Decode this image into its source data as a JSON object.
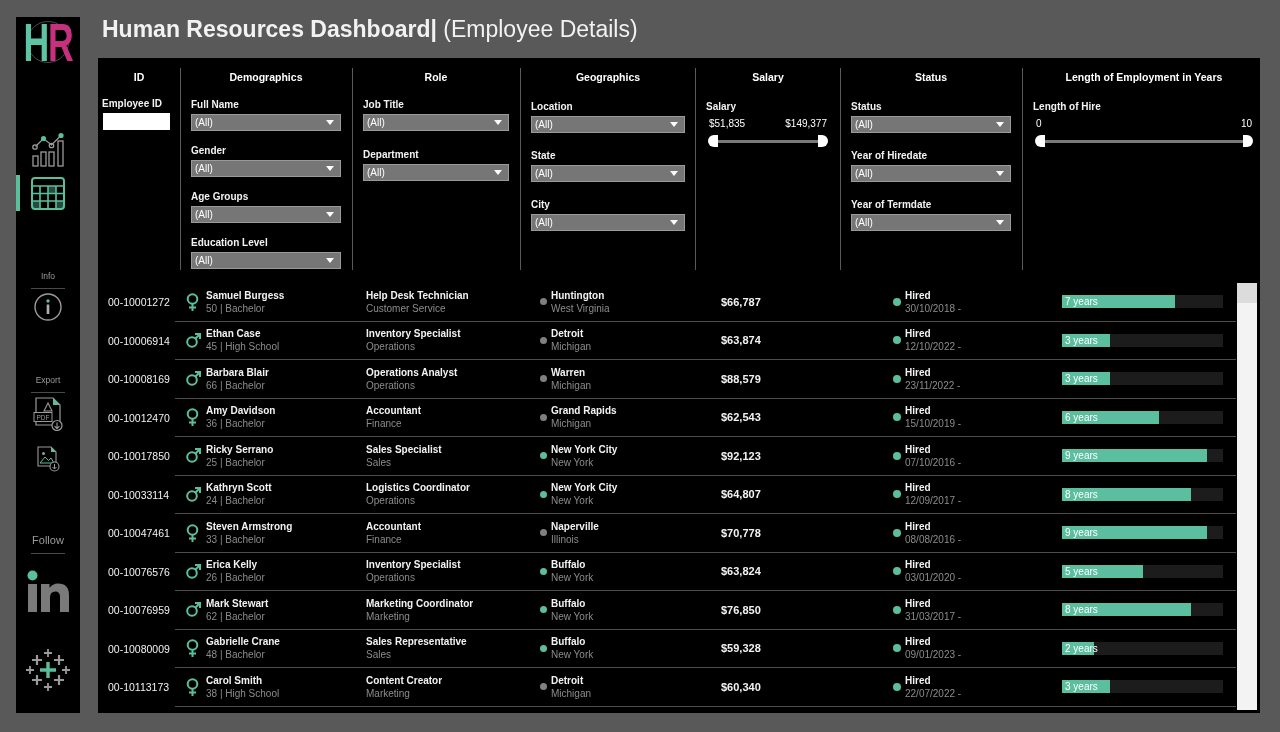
{
  "title": "**Human Resources Dashboard|** (Employee Details)",
  "sidebar": {
    "logo": [
      "H",
      "R"
    ],
    "nav": [
      {
        "kind": "chart",
        "selected": false
      },
      {
        "kind": "table",
        "selected": true
      }
    ],
    "sections": [
      {
        "label": "Info",
        "items": [
          {
            "kind": "info"
          }
        ]
      },
      {
        "label": "Export",
        "items": [
          {
            "kind": "pdf",
            "text": "PDF"
          },
          {
            "kind": "image"
          }
        ]
      },
      {
        "label": "Follow",
        "items": [
          {
            "kind": "linkedin"
          },
          {
            "kind": "tableau"
          }
        ]
      }
    ]
  },
  "filters": [
    {
      "heading": "ID",
      "controls": [
        {
          "kind": "text",
          "label": "Employee ID"
        }
      ]
    },
    {
      "heading": "Demographics",
      "controls": [
        {
          "kind": "dropdown",
          "label": "Full Name",
          "value": "(All)"
        },
        {
          "kind": "dropdown",
          "label": "Gender",
          "value": "(All)"
        },
        {
          "kind": "dropdown",
          "label": "Age Groups",
          "value": "(All)"
        },
        {
          "kind": "dropdown",
          "label": "Education Level",
          "value": "(All)"
        }
      ]
    },
    {
      "heading": "Role",
      "controls": [
        {
          "kind": "dropdown",
          "label": "Job Title",
          "value": "(All)"
        },
        {
          "kind": "dropdown",
          "label": "Department",
          "value": "(All)"
        }
      ]
    },
    {
      "heading": "Geographics",
      "controls": [
        {
          "kind": "dropdown",
          "label": "Location",
          "value": "(All)"
        },
        {
          "kind": "dropdown",
          "label": "State",
          "value": "(All)"
        },
        {
          "kind": "dropdown",
          "label": "City",
          "value": "(All)"
        }
      ]
    },
    {
      "heading": "Salary",
      "controls": [
        {
          "kind": "range",
          "label": "Salary",
          "min": "$51,835",
          "max": "$149,377",
          "handles": [
            {
              "level": 0
            },
            {
              "level": 1
            }
          ]
        }
      ]
    },
    {
      "heading": "Status",
      "controls": [
        {
          "kind": "dropdown",
          "label": "Status",
          "value": "(All)"
        },
        {
          "kind": "dropdown",
          "label": "Year of Hiredate",
          "value": "(All)"
        },
        {
          "kind": "dropdown",
          "label": "Year of Termdate",
          "value": "(All)"
        }
      ]
    },
    {
      "heading": "Length of Employment in Years",
      "controls": [
        {
          "kind": "range",
          "label": "Length of Hire",
          "min": "0",
          "max": "10",
          "handles": [
            {
              "level": 0
            },
            {
              "level": 1
            }
          ]
        }
      ]
    }
  ],
  "table": {
    "rows": [
      {
        "id": "00-10001272",
        "kind": "female",
        "name": "Samuel Burgess",
        "details": "50 | Bachelor",
        "job_title": "Help Desk Technician",
        "department": "Customer Service",
        "location": {
          "color": "#808080",
          "city": "Huntington",
          "state": "West Virginia"
        },
        "salary": "$66,787",
        "status": "Hired",
        "dates": "30/10/2018 -",
        "tenure": {
          "label": "7 years",
          "level": 0.7
        }
      },
      {
        "id": "00-10006914",
        "kind": "male",
        "name": "Ethan Case",
        "details": "45 | High School",
        "job_title": "Inventory Specialist",
        "department": "Operations",
        "location": {
          "color": "#808080",
          "city": "Detroit",
          "state": "Michigan"
        },
        "salary": "$63,874",
        "status": "Hired",
        "dates": "12/10/2022 -",
        "tenure": {
          "label": "3 years",
          "level": 0.3
        }
      },
      {
        "id": "00-10008169",
        "kind": "male",
        "name": "Barbara Blair",
        "details": "66 | Bachelor",
        "job_title": "Operations Analyst",
        "department": "Operations",
        "location": {
          "color": "#808080",
          "city": "Warren",
          "state": "Michigan"
        },
        "salary": "$88,579",
        "status": "Hired",
        "dates": "23/11/2022 -",
        "tenure": {
          "label": "3 years",
          "level": 0.3
        }
      },
      {
        "id": "00-10012470",
        "kind": "female",
        "name": "Amy Davidson",
        "details": "36 | Bachelor",
        "job_title": "Accountant",
        "department": "Finance",
        "location": {
          "color": "#808080",
          "city": "Grand Rapids",
          "state": "Michigan"
        },
        "salary": "$62,543",
        "status": "Hired",
        "dates": "15/10/2019 -",
        "tenure": {
          "label": "6 years",
          "level": 0.6
        }
      },
      {
        "id": "00-10017850",
        "kind": "male",
        "name": "Ricky Serrano",
        "details": "25 | Bachelor",
        "job_title": "Sales Specialist",
        "department": "Sales",
        "location": {
          "color": "#5bbf9f",
          "city": "New York City",
          "state": "New York"
        },
        "salary": "$92,123",
        "status": "Hired",
        "dates": "07/10/2016 -",
        "tenure": {
          "label": "9 years",
          "level": 0.9
        }
      },
      {
        "id": "00-10033114",
        "kind": "male",
        "name": "Kathryn Scott",
        "details": "24 | Bachelor",
        "job_title": "Logistics Coordinator",
        "department": "Operations",
        "location": {
          "color": "#5bbf9f",
          "city": "New York City",
          "state": "New York"
        },
        "salary": "$64,807",
        "status": "Hired",
        "dates": "12/09/2017 -",
        "tenure": {
          "label": "8 years",
          "level": 0.8
        }
      },
      {
        "id": "00-10047461",
        "kind": "female",
        "name": "Steven Armstrong",
        "details": "33 | Bachelor",
        "job_title": "Accountant",
        "department": "Finance",
        "location": {
          "color": "#808080",
          "city": "Naperville",
          "state": "Illinois"
        },
        "salary": "$70,778",
        "status": "Hired",
        "dates": "08/08/2016 -",
        "tenure": {
          "label": "9 years",
          "level": 0.9
        }
      },
      {
        "id": "00-10076576",
        "kind": "male",
        "name": "Erica Kelly",
        "details": "26 | Bachelor",
        "job_title": "Inventory Specialist",
        "department": "Operations",
        "location": {
          "color": "#5bbf9f",
          "city": "Buffalo",
          "state": "New York"
        },
        "salary": "$63,824",
        "status": "Hired",
        "dates": "03/01/2020 -",
        "tenure": {
          "label": "5 years",
          "level": 0.5
        }
      },
      {
        "id": "00-10076959",
        "kind": "male",
        "name": "Mark Stewart",
        "details": "62 | Bachelor",
        "job_title": "Marketing Coordinator",
        "department": "Marketing",
        "location": {
          "color": "#5bbf9f",
          "city": "Buffalo",
          "state": "New York"
        },
        "salary": "$76,850",
        "status": "Hired",
        "dates": "31/03/2017 -",
        "tenure": {
          "label": "8 years",
          "level": 0.8
        }
      },
      {
        "id": "00-10080009",
        "kind": "female",
        "name": "Gabrielle Crane",
        "details": "48 | Bachelor",
        "job_title": "Sales Representative",
        "department": "Sales",
        "location": {
          "color": "#5bbf9f",
          "city": "Buffalo",
          "state": "New York"
        },
        "salary": "$59,328",
        "status": "Hired",
        "dates": "09/01/2023 -",
        "tenure": {
          "label": "2 years",
          "level": 0.2
        }
      },
      {
        "id": "00-10113173",
        "kind": "female",
        "name": "Carol Smith",
        "details": "38 | High School",
        "job_title": "Content Creator",
        "department": "Marketing",
        "location": {
          "color": "#808080",
          "city": "Detroit",
          "state": "Michigan"
        },
        "salary": "$60,340",
        "status": "Hired",
        "dates": "22/07/2022 -",
        "tenure": {
          "label": "3 years",
          "level": 0.3
        }
      }
    ]
  }
}
